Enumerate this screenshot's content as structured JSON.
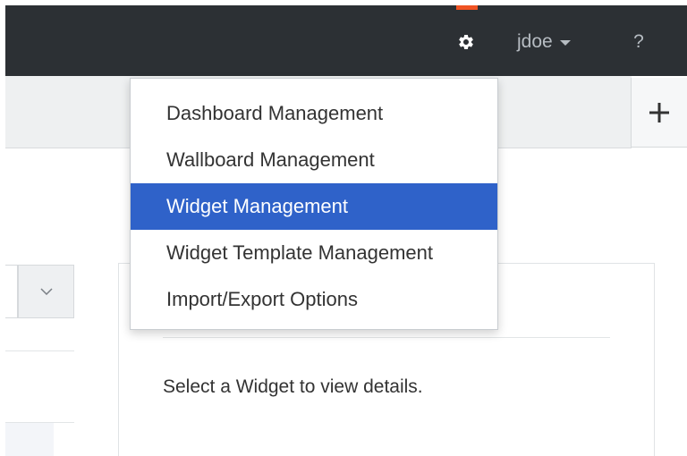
{
  "header": {
    "user_name": "jdoe",
    "help_label": "?",
    "accent_color": "#f05323",
    "bar_color": "#2c3034"
  },
  "icons": {
    "settings": "gear-icon",
    "user_menu": "caret-down-icon",
    "add": "plus-icon",
    "select": "chevron-down-icon"
  },
  "settings_menu": {
    "items": [
      {
        "label": "Dashboard Management",
        "active": false
      },
      {
        "label": "Wallboard Management",
        "active": false
      },
      {
        "label": "Widget Management",
        "active": true
      },
      {
        "label": "Widget Template Management",
        "active": false
      },
      {
        "label": "Import/Export Options",
        "active": false
      }
    ],
    "active_color": "#2f62c9"
  },
  "details": {
    "empty_message": "Select a Widget to view details."
  }
}
